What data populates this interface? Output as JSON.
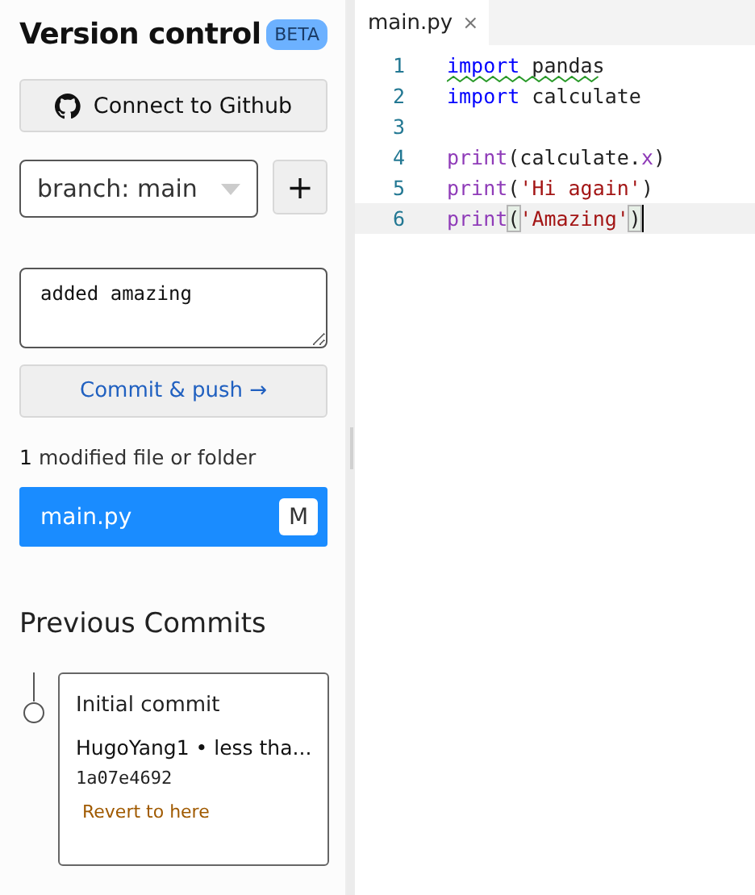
{
  "panel": {
    "title": "Version control",
    "badge": "BETA",
    "connect_button": "Connect to Github",
    "branch_select": {
      "value": "branch: main"
    },
    "add_button": "+",
    "commit_message": {
      "value": "added amazing"
    },
    "commit_button": "Commit & push →",
    "modified_count": "1",
    "modified_label": "modified file or folder",
    "files": [
      {
        "name": "main.py",
        "status": "M",
        "selected": true
      }
    ],
    "previous_title": "Previous Commits",
    "commits": [
      {
        "message": "Initial commit",
        "author_line": "HugoYang1 • less tha...",
        "hash": "1a07e4692",
        "revert": "Revert to here"
      }
    ]
  },
  "editor": {
    "tabs": [
      {
        "label": "main.py",
        "close": "×",
        "selected": true
      }
    ],
    "lines": [
      {
        "number": "1",
        "current": false,
        "warning": true,
        "tokens": [
          {
            "kind": "keyword",
            "text": "import"
          },
          {
            "kind": "plain",
            "text": " pandas"
          }
        ]
      },
      {
        "number": "2",
        "current": false,
        "tokens": [
          {
            "kind": "keyword",
            "text": "import"
          },
          {
            "kind": "plain",
            "text": " calculate"
          }
        ]
      },
      {
        "number": "3",
        "current": false
      },
      {
        "number": "4",
        "current": false,
        "tokens": [
          {
            "kind": "function",
            "text": "print"
          },
          {
            "kind": "plain",
            "text": "(calculate."
          },
          {
            "kind": "function",
            "text": "x"
          },
          {
            "kind": "plain",
            "text": ")"
          }
        ]
      },
      {
        "number": "5",
        "current": false,
        "tokens": [
          {
            "kind": "function",
            "text": "print"
          },
          {
            "kind": "plain",
            "text": "("
          },
          {
            "kind": "string",
            "text": "'Hi again'"
          },
          {
            "kind": "plain",
            "text": ")"
          }
        ]
      },
      {
        "number": "6",
        "current": true,
        "tokens": [
          {
            "kind": "function",
            "text": "print"
          },
          {
            "kind": "bracket",
            "text": "("
          },
          {
            "kind": "string",
            "text": "'Amazing'"
          },
          {
            "kind": "bracket",
            "text": ")"
          }
        ]
      }
    ]
  }
}
